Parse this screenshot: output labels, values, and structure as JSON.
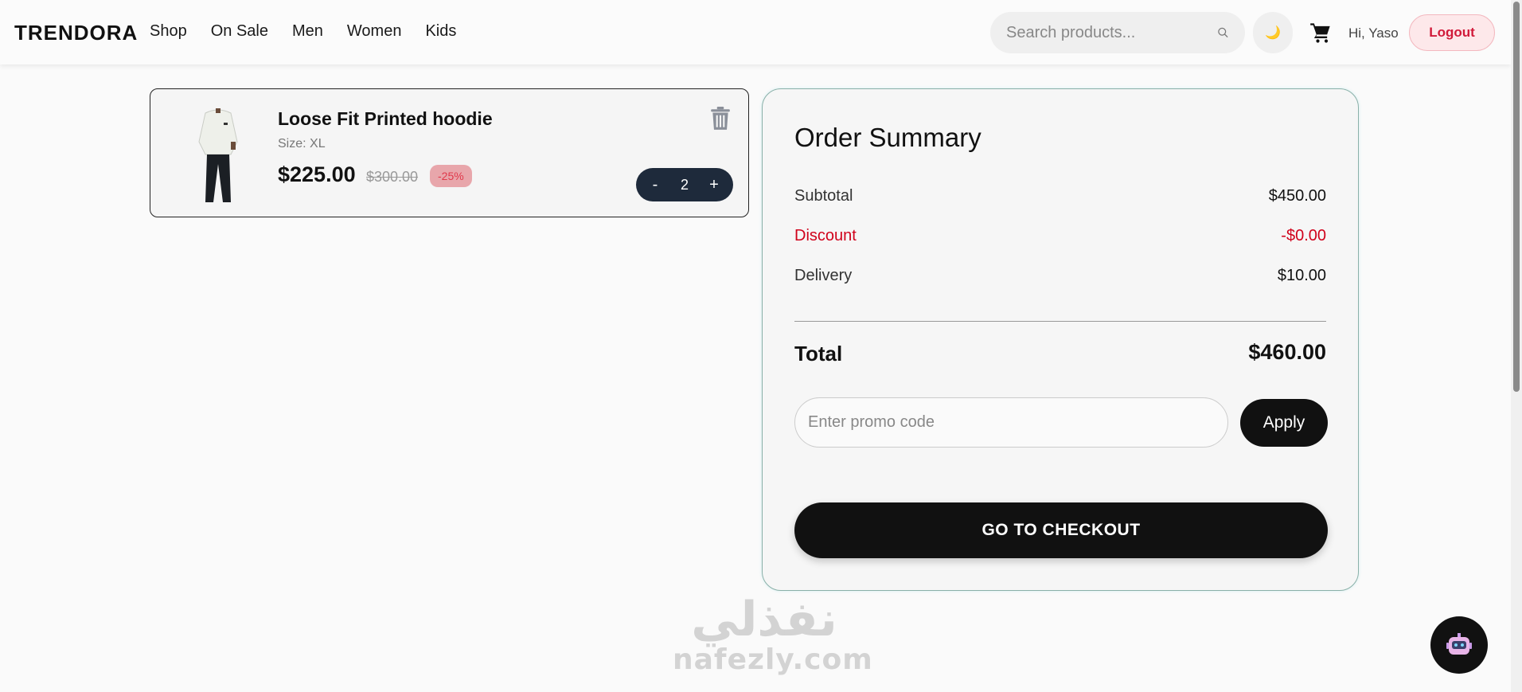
{
  "header": {
    "logo": "TRENDORA",
    "nav": [
      "Shop",
      "On Sale",
      "Men",
      "Women",
      "Kids"
    ],
    "search_placeholder": "Search products...",
    "theme_icon": "🌙",
    "greeting": "Hi, Yaso",
    "logout_label": "Logout"
  },
  "cart": {
    "items": [
      {
        "name": "Loose Fit Printed hoodie",
        "size": "Size: XL",
        "price": "$225.00",
        "old_price": "$300.00",
        "discount_badge": "-25%",
        "quantity": "2",
        "minus_label": "-",
        "plus_label": "+"
      }
    ]
  },
  "summary": {
    "title": "Order Summary",
    "subtotal_label": "Subtotal",
    "subtotal_value": "$450.00",
    "discount_label": "Discount",
    "discount_value": "-$0.00",
    "delivery_label": "Delivery",
    "delivery_value": "$10.00",
    "total_label": "Total",
    "total_value": "$460.00",
    "promo_placeholder": "Enter promo code",
    "apply_label": "Apply",
    "checkout_label": "GO TO CHECKOUT"
  },
  "watermark": {
    "arabic": "نفذلي",
    "latin": "nafezly.com"
  },
  "colors": {
    "accent_dark": "#111111",
    "discount_red": "#d0021b",
    "logout_red": "#d11a3a",
    "stepper_bg": "#1e2a3b"
  }
}
